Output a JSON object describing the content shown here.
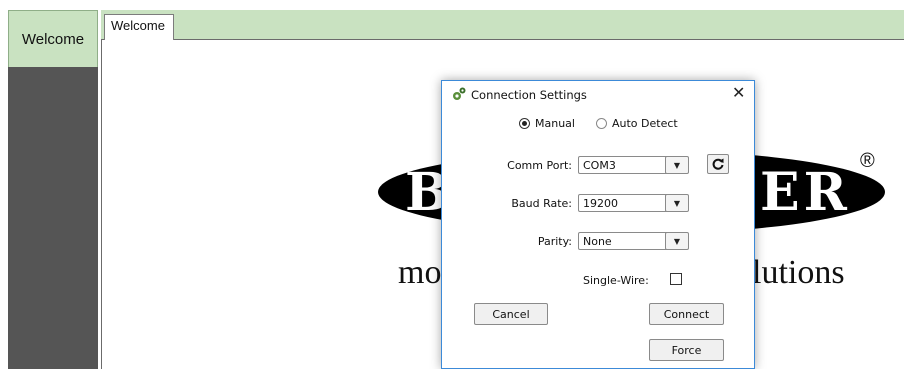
{
  "nav": {
    "welcome_label": "Welcome"
  },
  "tabs": [
    {
      "label": "Welcome"
    }
  ],
  "background_logo": {
    "left_letters": "B",
    "right_letters": "ER",
    "registered_mark": "®",
    "tagline_left": "mo",
    "tagline_right": "lutions"
  },
  "dialog": {
    "title": "Connection Settings",
    "close_glyph": "✕",
    "mode": {
      "options": [
        "Manual",
        "Auto Detect"
      ],
      "selected": "Manual"
    },
    "comm_port": {
      "label": "Comm Port:",
      "value": "COM3"
    },
    "baud_rate": {
      "label": "Baud Rate:",
      "value": "19200"
    },
    "parity": {
      "label": "Parity:",
      "value": "None"
    },
    "single_wire": {
      "label": "Single-Wire:",
      "checked": false
    },
    "buttons": {
      "cancel": "Cancel",
      "connect": "Connect",
      "force": "Force"
    },
    "dropdown_glyph": "▼"
  },
  "colors": {
    "tab_green": "#c9e2c1",
    "nav_dark": "#555555",
    "dialog_border": "#3c8ad8"
  }
}
